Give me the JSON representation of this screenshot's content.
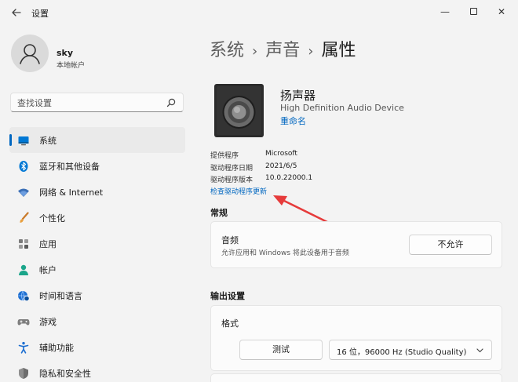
{
  "window": {
    "title": "设置",
    "controls": {
      "minimize": "—",
      "close": "✕"
    }
  },
  "user": {
    "name": "sky",
    "account_type": "本地帐户"
  },
  "search": {
    "placeholder": "查找设置"
  },
  "sidebar": {
    "items": [
      {
        "label": "系统",
        "icon": "system-icon",
        "active": true
      },
      {
        "label": "蓝牙和其他设备",
        "icon": "bluetooth-icon"
      },
      {
        "label": "网络 & Internet",
        "icon": "wifi-icon"
      },
      {
        "label": "个性化",
        "icon": "brush-icon"
      },
      {
        "label": "应用",
        "icon": "apps-icon"
      },
      {
        "label": "帐户",
        "icon": "account-icon"
      },
      {
        "label": "时间和语言",
        "icon": "globe-clock-icon"
      },
      {
        "label": "游戏",
        "icon": "gamepad-icon"
      },
      {
        "label": "辅助功能",
        "icon": "accessibility-icon"
      },
      {
        "label": "隐私和安全性",
        "icon": "shield-icon"
      }
    ]
  },
  "breadcrumb": {
    "level1": "系统",
    "level2": "声音",
    "current": "属性",
    "separator": "›"
  },
  "device": {
    "name": "扬声器",
    "description": "High Definition Audio Device",
    "rename_label": "重命名",
    "info": [
      {
        "label": "提供程序",
        "value": "Microsoft"
      },
      {
        "label": "驱动程序日期",
        "value": "2021/6/5"
      },
      {
        "label": "驱动程序版本",
        "value": "10.0.22000.1"
      }
    ],
    "update_link": "检查驱动程序更新"
  },
  "general": {
    "title": "常规",
    "audio_title": "音频",
    "audio_desc": "允许应用和 Windows 将此设备用于音频",
    "deny_button": "不允许"
  },
  "output": {
    "title": "输出设置",
    "format_label": "格式",
    "test_button": "测试",
    "format_value": "16 位，96000 Hz (Studio Quality)"
  },
  "colors": {
    "accent": "#0067c0",
    "annotation_arrow": "#e63b3b",
    "background": "#f3f3f3"
  }
}
